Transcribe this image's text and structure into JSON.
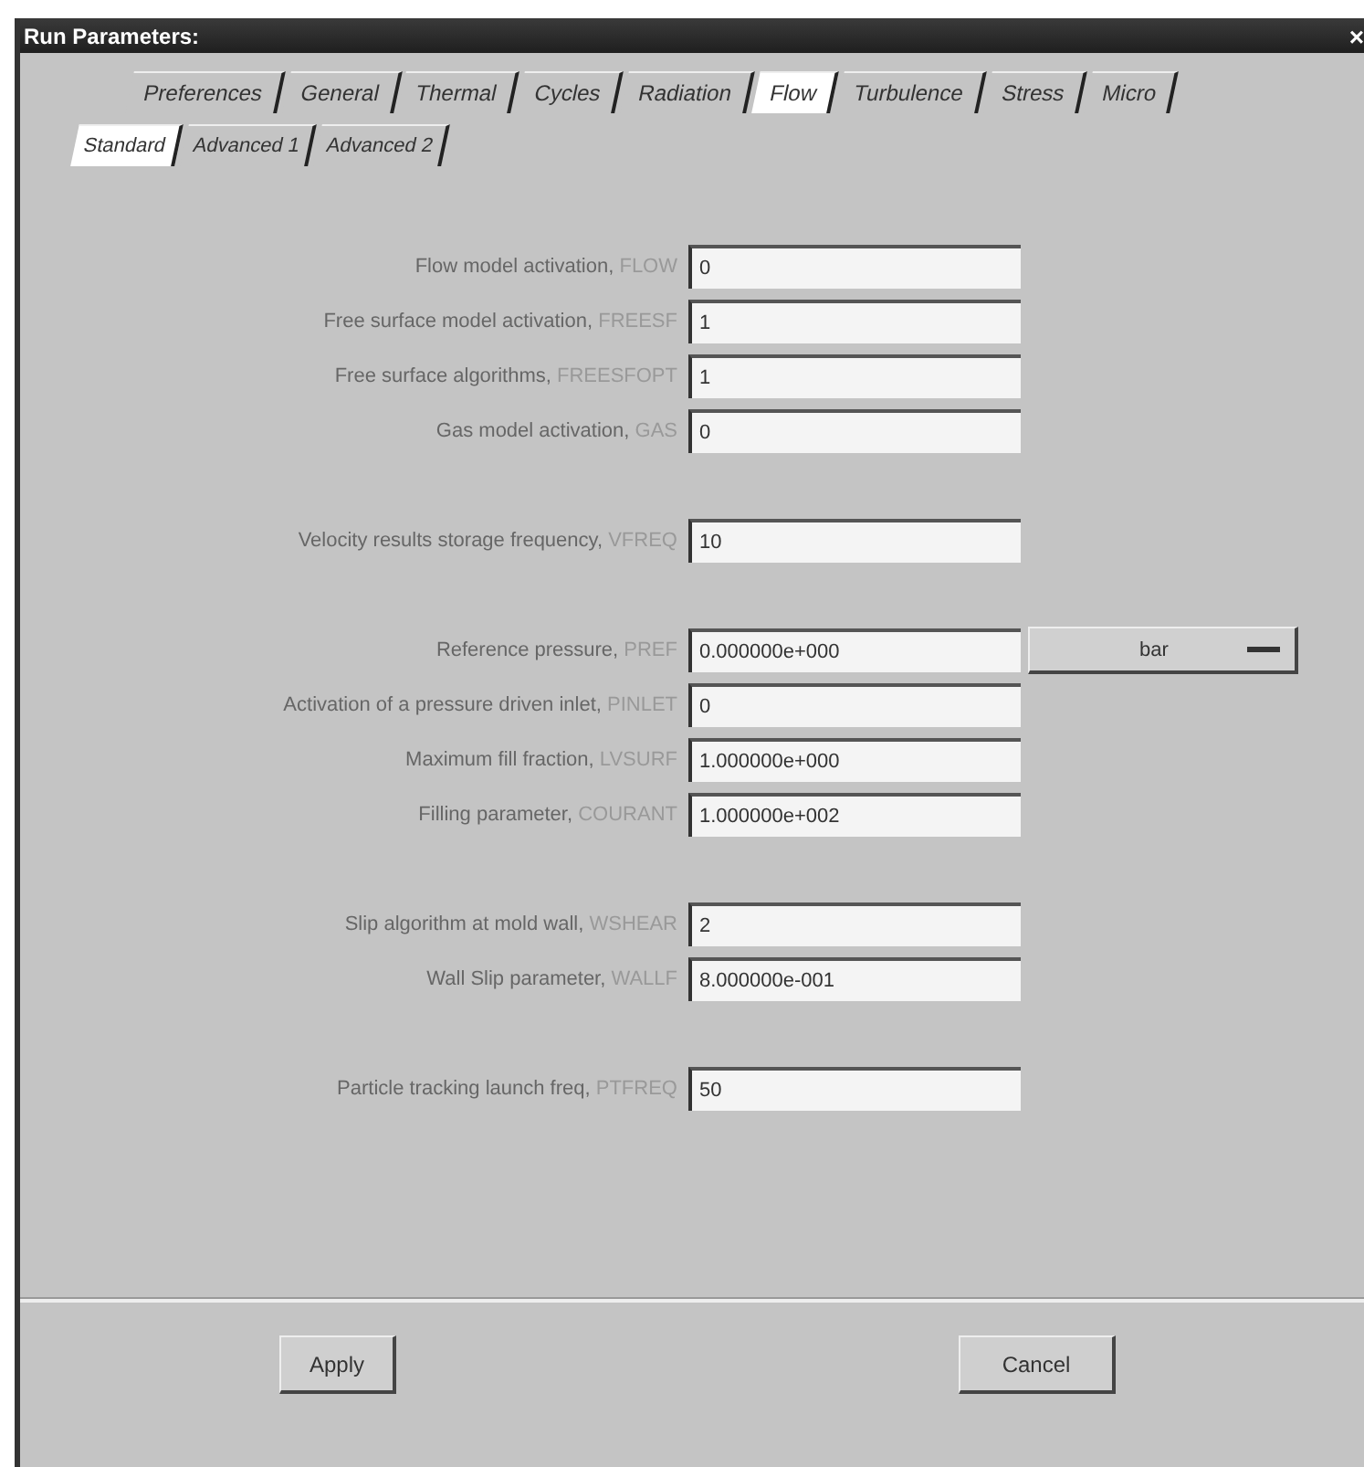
{
  "window": {
    "title": "Run Parameters:",
    "close": "×"
  },
  "tabs": [
    {
      "label": "Preferences",
      "selected": false
    },
    {
      "label": "General",
      "selected": false
    },
    {
      "label": "Thermal",
      "selected": false
    },
    {
      "label": "Cycles",
      "selected": false
    },
    {
      "label": "Radiation",
      "selected": false
    },
    {
      "label": "Flow",
      "selected": true
    },
    {
      "label": "Turbulence",
      "selected": false
    },
    {
      "label": "Stress",
      "selected": false
    },
    {
      "label": "Micro",
      "selected": false
    }
  ],
  "subtabs": [
    {
      "label": "Standard",
      "selected": true
    },
    {
      "label": "Advanced 1",
      "selected": false
    },
    {
      "label": "Advanced 2",
      "selected": false
    }
  ],
  "groups": [
    {
      "fields": [
        {
          "label": "Flow model activation,",
          "code": "FLOW",
          "value": "0"
        },
        {
          "label": "Free surface model activation,",
          "code": "FREESF",
          "value": "1"
        },
        {
          "label": "Free surface algorithms,",
          "code": "FREESFOPT",
          "value": "1"
        },
        {
          "label": "Gas model activation,",
          "code": "GAS",
          "value": "0"
        }
      ]
    },
    {
      "fields": [
        {
          "label": "Velocity results storage frequency,",
          "code": "VFREQ",
          "value": "10"
        }
      ]
    },
    {
      "fields": [
        {
          "label": "Reference pressure,",
          "code": "PREF",
          "value": "0.000000e+000",
          "unit": "bar"
        },
        {
          "label": "Activation of a pressure driven inlet,",
          "code": "PINLET",
          "value": "0"
        },
        {
          "label": "Maximum fill fraction,",
          "code": "LVSURF",
          "value": "1.000000e+000"
        },
        {
          "label": "Filling parameter,",
          "code": "COURANT",
          "value": "1.000000e+002"
        }
      ]
    },
    {
      "fields": [
        {
          "label": "Slip algorithm at mold wall,",
          "code": "WSHEAR",
          "value": "2"
        },
        {
          "label": "Wall Slip parameter,",
          "code": "WALLF",
          "value": "8.000000e-001"
        }
      ]
    },
    {
      "fields": [
        {
          "label": "Particle tracking launch freq,",
          "code": "PTFREQ",
          "value": "50"
        }
      ]
    }
  ],
  "buttons": [
    "Apply",
    "Cancel"
  ]
}
